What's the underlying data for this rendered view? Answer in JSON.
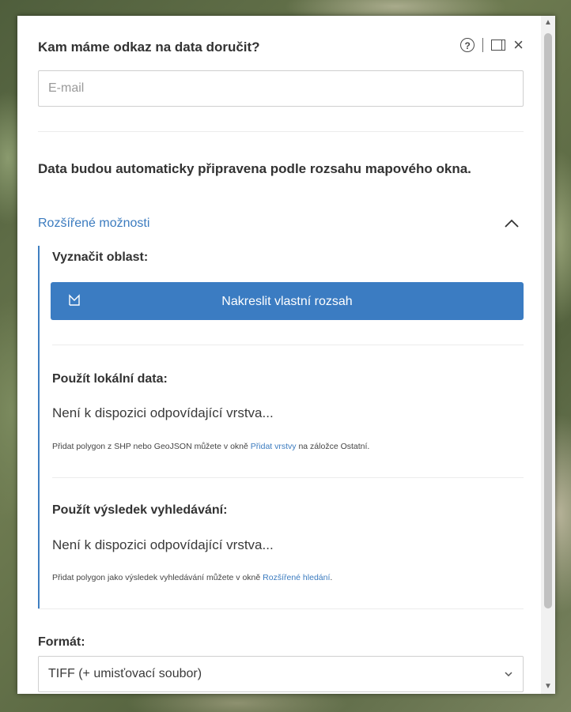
{
  "header": {
    "title": "Kam máme odkaz na data doručit?",
    "help_label": "?"
  },
  "email": {
    "placeholder": "E-mail",
    "value": ""
  },
  "info_text": "Data budou automaticky připravena podle rozsahu mapového okna.",
  "advanced": {
    "link_label": "Rozšířené možnosti",
    "expanded": true,
    "mark_area_label": "Vyznačit oblast:",
    "draw_button_label": "Nakreslit vlastní rozsah",
    "local_data": {
      "label": "Použít lokální data:",
      "status": "Není k dispozici odpovídající vrstva...",
      "hint_before": "Přidat polygon z SHP nebo GeoJSON můžete v okně ",
      "hint_link": "Přidat vrstvy",
      "hint_after": " na záložce Ostatní."
    },
    "search_result": {
      "label": "Použít výsledek vyhledávání:",
      "status": "Není k dispozici odpovídající vrstva...",
      "hint_before": "Přidat polygon jako výsledek vyhledávání můžete v okně ",
      "hint_link": "Rozšířené hledání",
      "hint_after": "."
    }
  },
  "format": {
    "label": "Formát:",
    "selected": "TIFF (+ umisťovací soubor)"
  },
  "colors": {
    "accent": "#3b7cc2",
    "link": "#3b7bbf"
  }
}
